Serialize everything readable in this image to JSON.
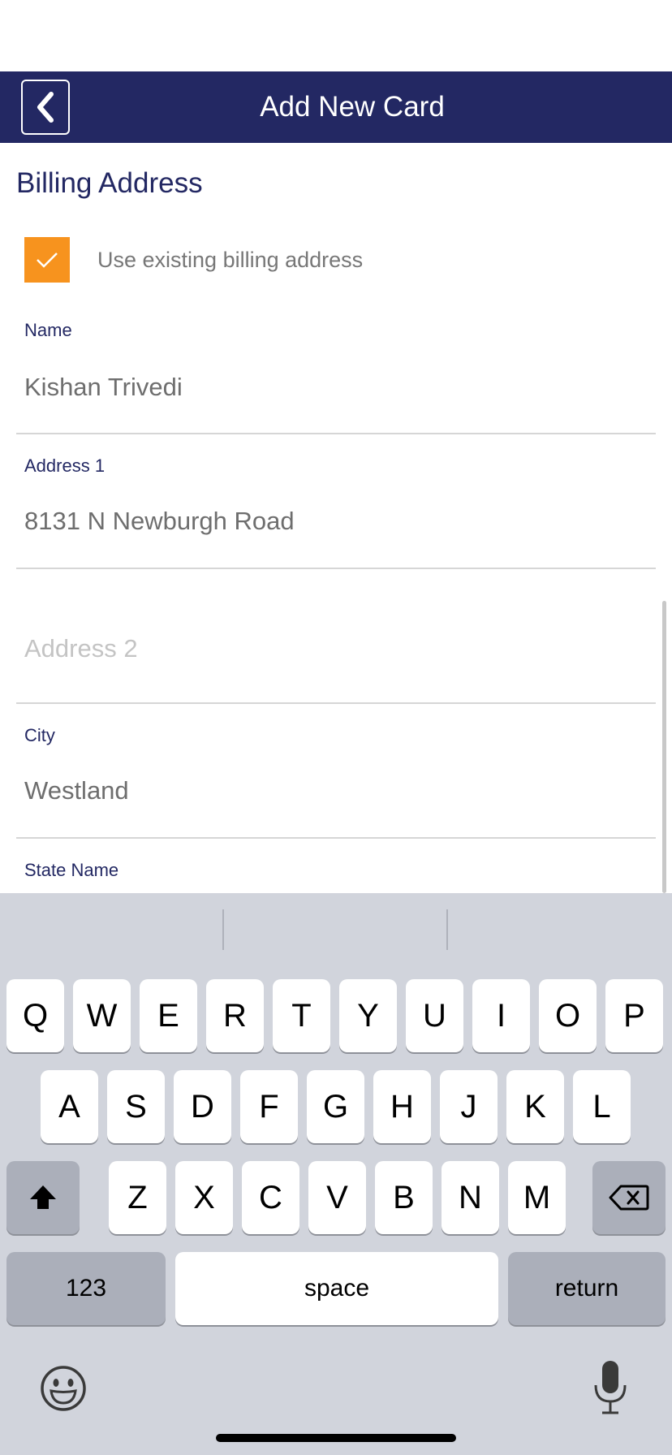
{
  "header": {
    "title": "Add New Card",
    "back_icon": "chevron-left-icon"
  },
  "section": {
    "title": "Billing Address"
  },
  "checkbox": {
    "label": "Use existing billing address",
    "checked": true,
    "color": "#f7931e"
  },
  "fields": {
    "name": {
      "label": "Name",
      "value": "Kishan Trivedi"
    },
    "address1": {
      "label": "Address 1",
      "value": "8131 N Newburgh Road"
    },
    "address2": {
      "placeholder": "Address 2"
    },
    "city": {
      "label": "City",
      "value": "Westland"
    },
    "state": {
      "label": "State Name"
    }
  },
  "keyboard": {
    "row1": [
      "Q",
      "W",
      "E",
      "R",
      "T",
      "Y",
      "U",
      "I",
      "O",
      "P"
    ],
    "row2": [
      "A",
      "S",
      "D",
      "F",
      "G",
      "H",
      "J",
      "K",
      "L"
    ],
    "row3": [
      "Z",
      "X",
      "C",
      "V",
      "B",
      "N",
      "M"
    ],
    "numbers": "123",
    "space": "space",
    "return": "return"
  },
  "colors": {
    "nav": "#232863",
    "accent": "#f7931e"
  }
}
